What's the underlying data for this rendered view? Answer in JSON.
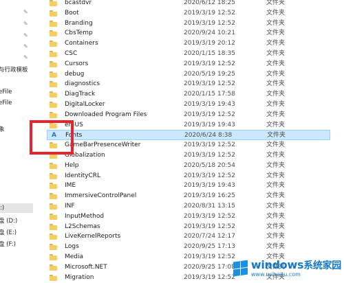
{
  "nav": {
    "items": [
      {
        "label": "与行政模板"
      },
      {
        "label": "eFile"
      },
      {
        "label": "eFile"
      },
      {
        "label": "象"
      },
      {
        "label": ":)"
      },
      {
        "label": "盘 (D:)"
      },
      {
        "label": "盘 (E:)"
      },
      {
        "label": "盘 (F:)"
      }
    ]
  },
  "files": [
    {
      "name": "bcastdvr",
      "date": "2020/6/12 18:25",
      "type": "文件夹"
    },
    {
      "name": "Boot",
      "date": "2019/3/19 12:52",
      "type": "文件夹"
    },
    {
      "name": "Branding",
      "date": "2019/3/19 12:52",
      "type": "文件夹"
    },
    {
      "name": "CbsTemp",
      "date": "2020/9/24 10:21",
      "type": "文件夹"
    },
    {
      "name": "Containers",
      "date": "2019/3/19 20:12",
      "type": "文件夹"
    },
    {
      "name": "CSC",
      "date": "2020/1/15 18:35",
      "type": "文件夹"
    },
    {
      "name": "Cursors",
      "date": "2019/3/19 12:52",
      "type": "文件夹"
    },
    {
      "name": "debug",
      "date": "2020/5/19 19:25",
      "type": "文件夹"
    },
    {
      "name": "diagnostics",
      "date": "2019/3/19 12:52",
      "type": "文件夹"
    },
    {
      "name": "DiagTrack",
      "date": "2020/1/15 17:58",
      "type": "文件夹"
    },
    {
      "name": "DigitalLocker",
      "date": "2019/3/19 19:43",
      "type": "文件夹"
    },
    {
      "name": "Downloaded Program Files",
      "date": "2019/3/19 12:52",
      "type": "文件夹"
    },
    {
      "name": "en-US",
      "date": "2019/3/19 19:43",
      "type": "文件夹"
    },
    {
      "name": "Fonts",
      "date": "2020/6/24 8:38",
      "type": "文件夹"
    },
    {
      "name": "GameBarPresenceWriter",
      "date": "2019/3/19 12:52",
      "type": "文件夹"
    },
    {
      "name": "Globalization",
      "date": "2019/3/19 12:52",
      "type": "文件夹"
    },
    {
      "name": "Help",
      "date": "2020/5/18 20:54",
      "type": "文件夹"
    },
    {
      "name": "IdentityCRL",
      "date": "2019/3/19 12:52",
      "type": "文件夹"
    },
    {
      "name": "IME",
      "date": "2019/3/19 19:43",
      "type": "文件夹"
    },
    {
      "name": "ImmersiveControlPanel",
      "date": "2019/3/19 16:25",
      "type": "文件夹"
    },
    {
      "name": "INF",
      "date": "2020/8/31 13:15",
      "type": "文件夹"
    },
    {
      "name": "InputMethod",
      "date": "2019/3/19 12:52",
      "type": "文件夹"
    },
    {
      "name": "L2Schemas",
      "date": "2019/3/19 12:52",
      "type": "文件夹"
    },
    {
      "name": "LiveKernelReports",
      "date": "2020/7/24 12:17",
      "type": "文件夹"
    },
    {
      "name": "Logs",
      "date": "2020/9/25 17:13",
      "type": "文件夹"
    },
    {
      "name": "Media",
      "date": "2019/3/19 12:52",
      "type": "文件夹"
    },
    {
      "name": "Microsoft.NET",
      "date": "2020/9/25 17:08",
      "type": "文件夹"
    },
    {
      "name": "Migration",
      "date": "2019/3/19 12:52",
      "type": "文件夹"
    }
  ],
  "selected_name": "Fonts",
  "watermark": {
    "title": "windows",
    "title_cn": "系统家园",
    "url": "www.ruihaitu.com"
  },
  "colors": {
    "selection": "#cce8ff",
    "highlight_box": "#e8232b",
    "folder": "#f5cd61",
    "watermark": "#1679c9"
  }
}
